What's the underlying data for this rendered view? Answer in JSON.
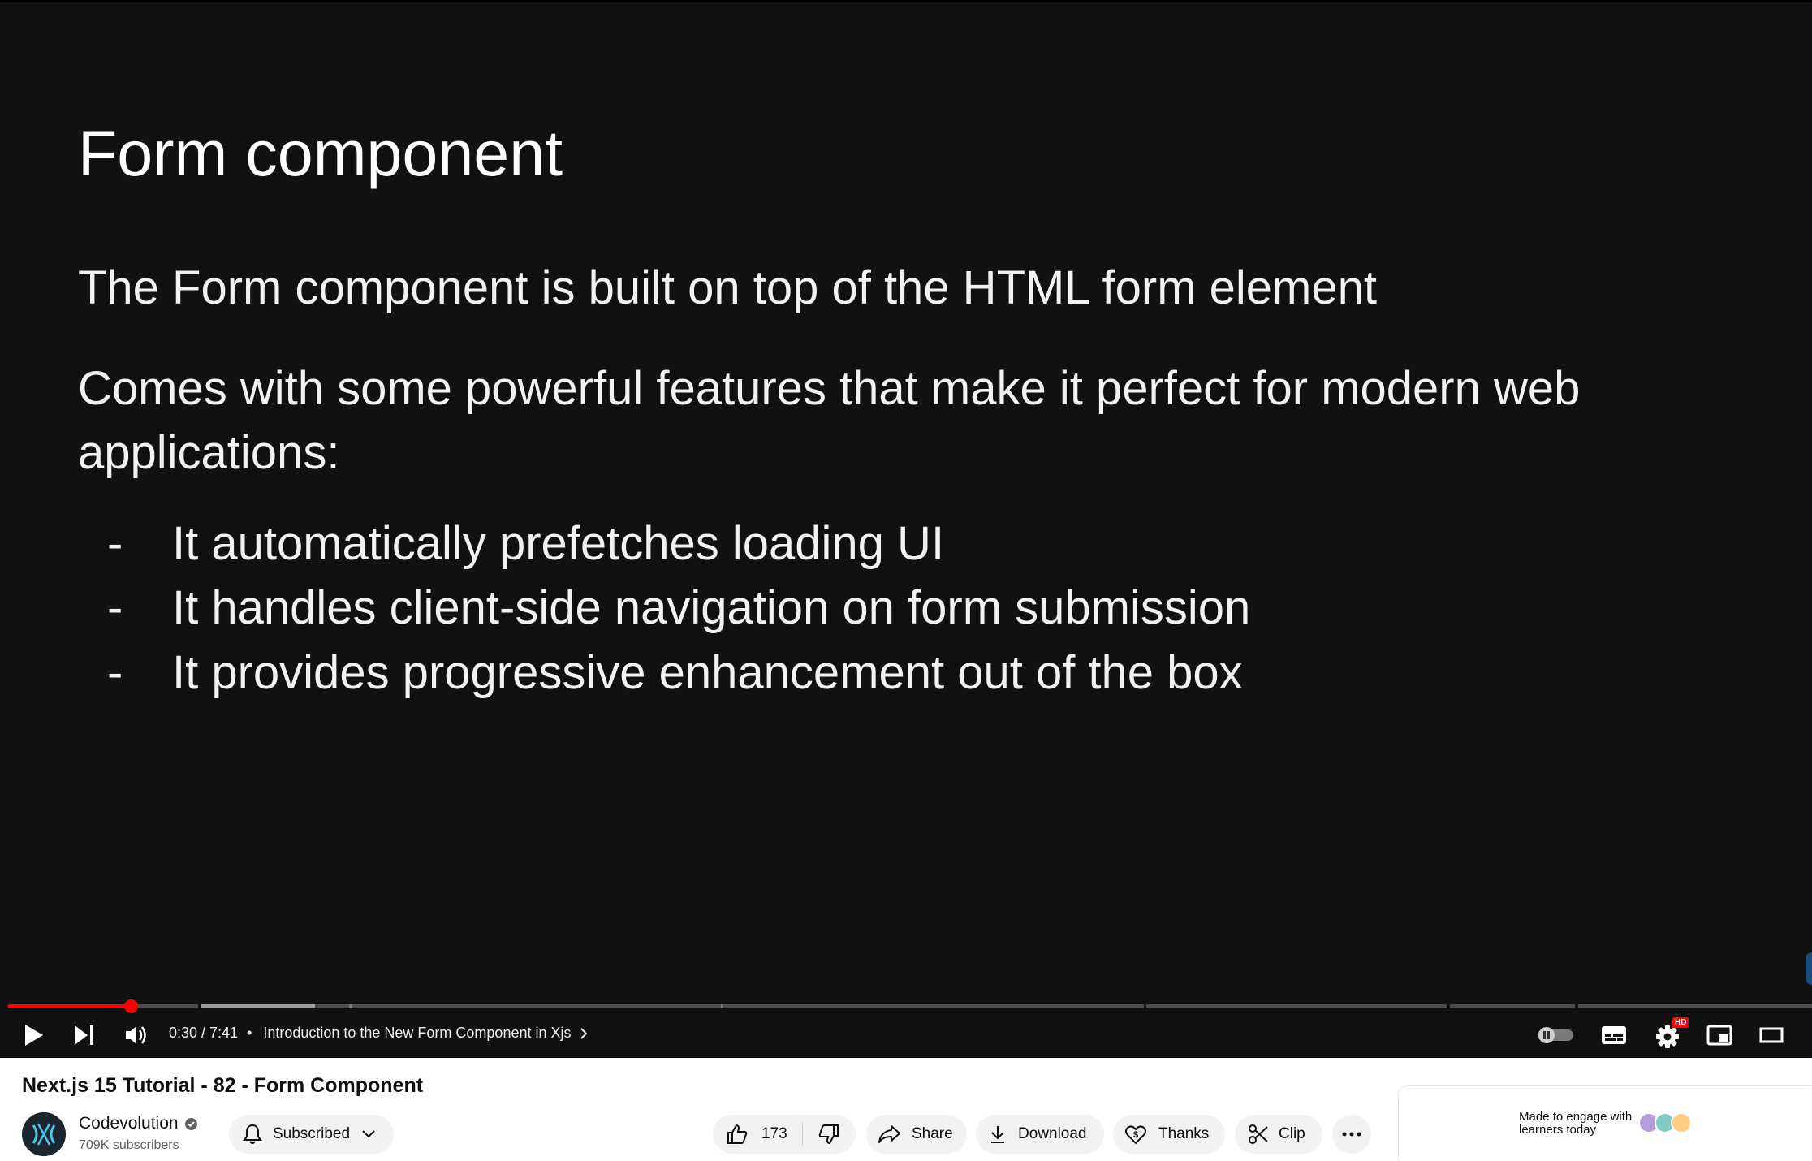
{
  "slide": {
    "title": "Form component",
    "line1": "The Form component is built on top of the HTML form element",
    "line2": "Comes with some powerful features that make it perfect for modern web applications:",
    "bullet_marker": "-",
    "bullets": [
      "It automatically prefetches loading UI",
      "It handles client-side navigation on form submission",
      "It provides progressive enhancement out of the box"
    ]
  },
  "player": {
    "progress_fraction": 0.068,
    "time": "0:30 / 7:41",
    "separator": "•",
    "chapter": "Introduction to the New Form Component in Xjs",
    "hd_badge": "HD",
    "accent_color": "#ff0000",
    "icons": [
      "play-icon",
      "next-icon",
      "volume-icon",
      "chevron-right-icon",
      "autoplay-toggle",
      "subtitles-icon",
      "settings-icon",
      "miniplayer-icon",
      "theater-icon"
    ]
  },
  "video": {
    "title": "Next.js 15 Tutorial - 82 - Form Component"
  },
  "channel": {
    "name": "Codevolution",
    "subscribers": "709K subscribers",
    "subscribe_label": "Subscribed"
  },
  "actions": {
    "likes": "173",
    "share": "Share",
    "download": "Download",
    "thanks": "Thanks",
    "clip": "Clip"
  },
  "promo": {
    "text": "Made to engage with learners today"
  }
}
